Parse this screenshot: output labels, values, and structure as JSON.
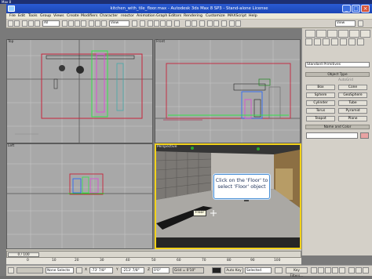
{
  "outer_title": "Max 8",
  "window": {
    "title": "kitchen_with_tile_floor.max - Autodesk 3ds Max 8 SP3 - Stand-alone License",
    "minimize": "_",
    "maximize": "□",
    "close": "×"
  },
  "menu": [
    "File",
    "Edit",
    "Tools",
    "Group",
    "Views",
    "Create",
    "Modifiers",
    "Character",
    "reactor",
    "Animation",
    "Graph Editors",
    "Rendering",
    "Customize",
    "MAXScript",
    "Help"
  ],
  "toolbar": {
    "selection_filter": "All",
    "reference_coord": "View",
    "view_dropdown": "View"
  },
  "viewports": {
    "top": "Top",
    "front": "Front",
    "left": "Left",
    "perspective": "Perspective"
  },
  "command_panel": {
    "category": "Standard Primitives",
    "object_type_header": "Object Type",
    "autogrid": "AutoGrid",
    "buttons": [
      "Box",
      "Cone",
      "Sphere",
      "GeoSphere",
      "Cylinder",
      "Tube",
      "Torus",
      "Pyramid",
      "Teapot",
      "Plane"
    ],
    "name_color_header": "Name and Color"
  },
  "callout": {
    "line1": "Click on the 'Floor' to",
    "line2": "select 'Floor' object"
  },
  "floor_tooltip": "Floor",
  "timeline": {
    "slider": "0 / 100",
    "ticks": [
      "0",
      "10",
      "20",
      "30",
      "40",
      "50",
      "60",
      "70",
      "80",
      "90",
      "100"
    ],
    "selection_status": "None Selecte",
    "x_label": "X",
    "x_value": "-73' 7/8\"",
    "y_label": "Y",
    "y_value": "-213' 7/8\"",
    "z_label": "Z",
    "z_value": "0'0\"",
    "grid": "Grid = 0'10\"",
    "auto_key": "Auto Key",
    "set_key_mode": "Selected",
    "key_filters": "Key Filters..."
  },
  "colors": {
    "title_bar": "#2a5bd3",
    "menu_bg": "#ece9d8",
    "panel_bg": "#d4d0c8",
    "active_viewport_border": "#f2d21a",
    "viewport_bg": "#a8a8a8"
  }
}
